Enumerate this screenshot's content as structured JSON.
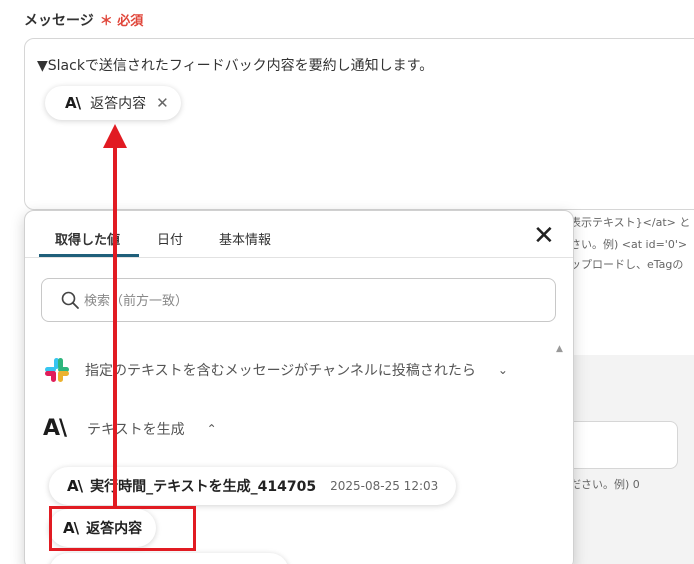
{
  "form": {
    "field_label": "メッセージ",
    "required_mark": "＊",
    "required_text": "必須"
  },
  "message": {
    "text": "▼Slackで送信されたフィードバック内容を要約し通知します。",
    "token_label": "返答内容",
    "token_icon": "anthropic-icon",
    "remove_icon": "close-icon"
  },
  "background_help": [
    "表示テキスト}</at> と",
    "さい。例) <at id='0'>",
    "ップロードし、eTagの",
    "ださい。例) 0"
  ],
  "popup": {
    "tabs": [
      {
        "label": "取得した値",
        "active": true
      },
      {
        "label": "日付",
        "active": false
      },
      {
        "label": "基本情報",
        "active": false
      }
    ],
    "close_icon": "close-icon",
    "search_placeholder": "検索（前方一致）",
    "sections": [
      {
        "label": "指定のテキストを含むメッセージがチャンネルに投稿されたら",
        "icon": "slack-icon",
        "chevron": "⌄",
        "expanded": false
      },
      {
        "label": "テキストを生成",
        "icon": "anthropic-icon",
        "chevron": "⌃",
        "expanded": true
      }
    ],
    "items": [
      {
        "label": "実行時間_テキストを生成_414705",
        "timestamp": "2025-08-25 12:03"
      },
      {
        "label": "返答内容",
        "timestamp": ""
      }
    ]
  },
  "annotation": {
    "color": "#e11b22"
  }
}
